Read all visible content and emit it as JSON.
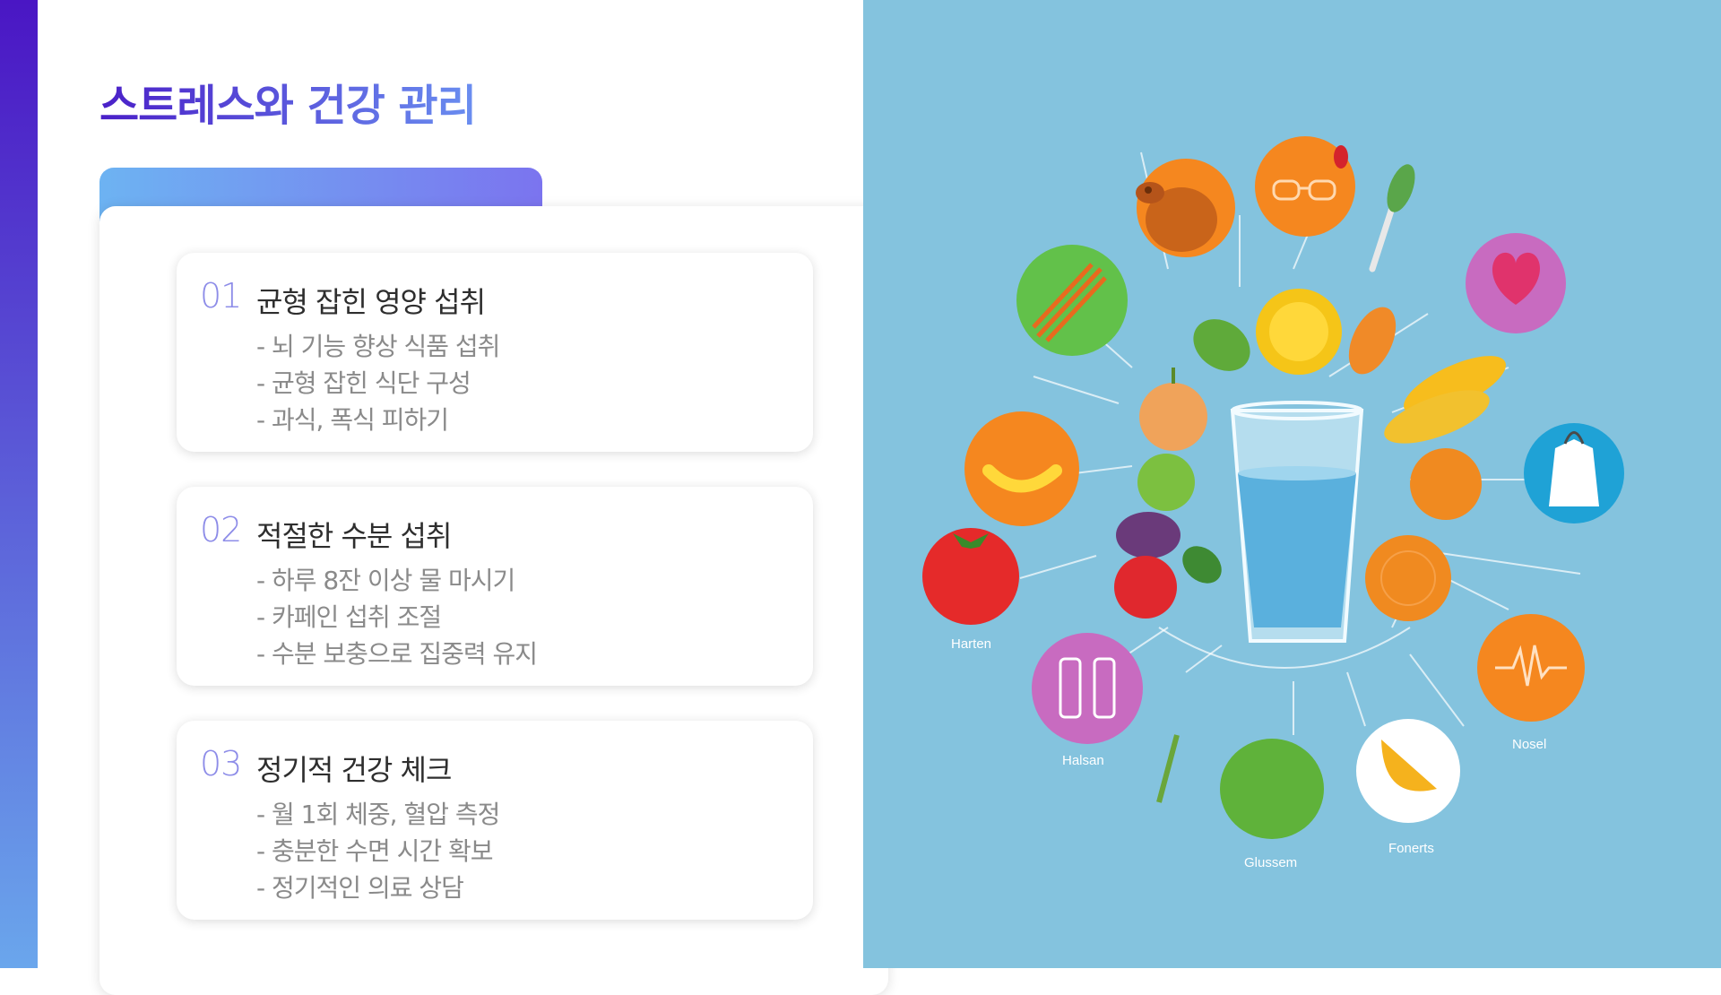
{
  "slide": {
    "title": "스트레스와 건강 관리",
    "colors": {
      "accent_start": "#4a20c8",
      "accent_end": "#6a8ef0",
      "number": "#8d8ce8",
      "illustration_bg": "#84c3de"
    }
  },
  "cards": [
    {
      "number": "01",
      "title": "균형 잡힌 영양 섭취",
      "items": [
        "- 뇌 기능 향상 식품 섭취",
        "- 균형 잡힌 식단 구성",
        "- 과식, 폭식 피하기"
      ]
    },
    {
      "number": "02",
      "title": "적절한 수분 섭취",
      "items": [
        "- 하루 8잔 이상 물 마시기",
        "- 카페인 섭취 조절",
        "- 수분 보충으로 집중력 유지"
      ]
    },
    {
      "number": "03",
      "title": "정기적 건강 체크",
      "items": [
        "- 월 1회 체중, 혈압 측정",
        "- 충분한 수면 시간 확보",
        "- 정기적인 의료 상담"
      ]
    }
  ],
  "illustration": {
    "labels": [
      "Harten",
      "Halsan",
      "Glussem",
      "Fonerts",
      "Nosel"
    ],
    "icons": [
      "roast-chicken-icon",
      "glasses-icon",
      "brush-icon",
      "heart-icon",
      "carrot-sticks-icon",
      "lemon-icon",
      "apple-icon",
      "water-glass-icon",
      "stethoscope-coat-icon",
      "tomato-icon",
      "water-bottles-icon",
      "leaf-icon",
      "banana-icon",
      "heartbeat-icon"
    ]
  }
}
